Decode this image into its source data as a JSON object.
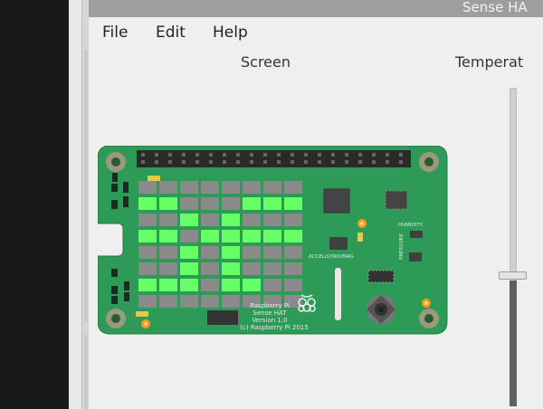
{
  "window": {
    "title": "Sense HA"
  },
  "menu": {
    "items": [
      "File",
      "Edit",
      "Help"
    ]
  },
  "labels": {
    "screen": "Screen",
    "temperature": "Temperat"
  },
  "board": {
    "name_line1": "Raspberry Pi",
    "name_line2": "Sense HAT",
    "version": "Version 1.0",
    "copyright": "(c) Raspberry Pi 2015",
    "sensor_accel": "ACCEL/GYRO/MAG",
    "sensor_humidity": "HUMIDITY",
    "sensor_pressure": "PRESSURE"
  },
  "led_matrix": {
    "on_color": "#66ff66",
    "off_color": "#8a8a8a",
    "rows": [
      "00000000",
      "11000111",
      "00101000",
      "11011111",
      "00101000",
      "00101000",
      "11101100",
      "00000000"
    ]
  },
  "temperature_slider": {
    "value_fraction": 0.39
  },
  "colors": {
    "pcb": "#2e9a58",
    "window_bg": "#efefef",
    "titlebar": "#9e9e9e"
  }
}
